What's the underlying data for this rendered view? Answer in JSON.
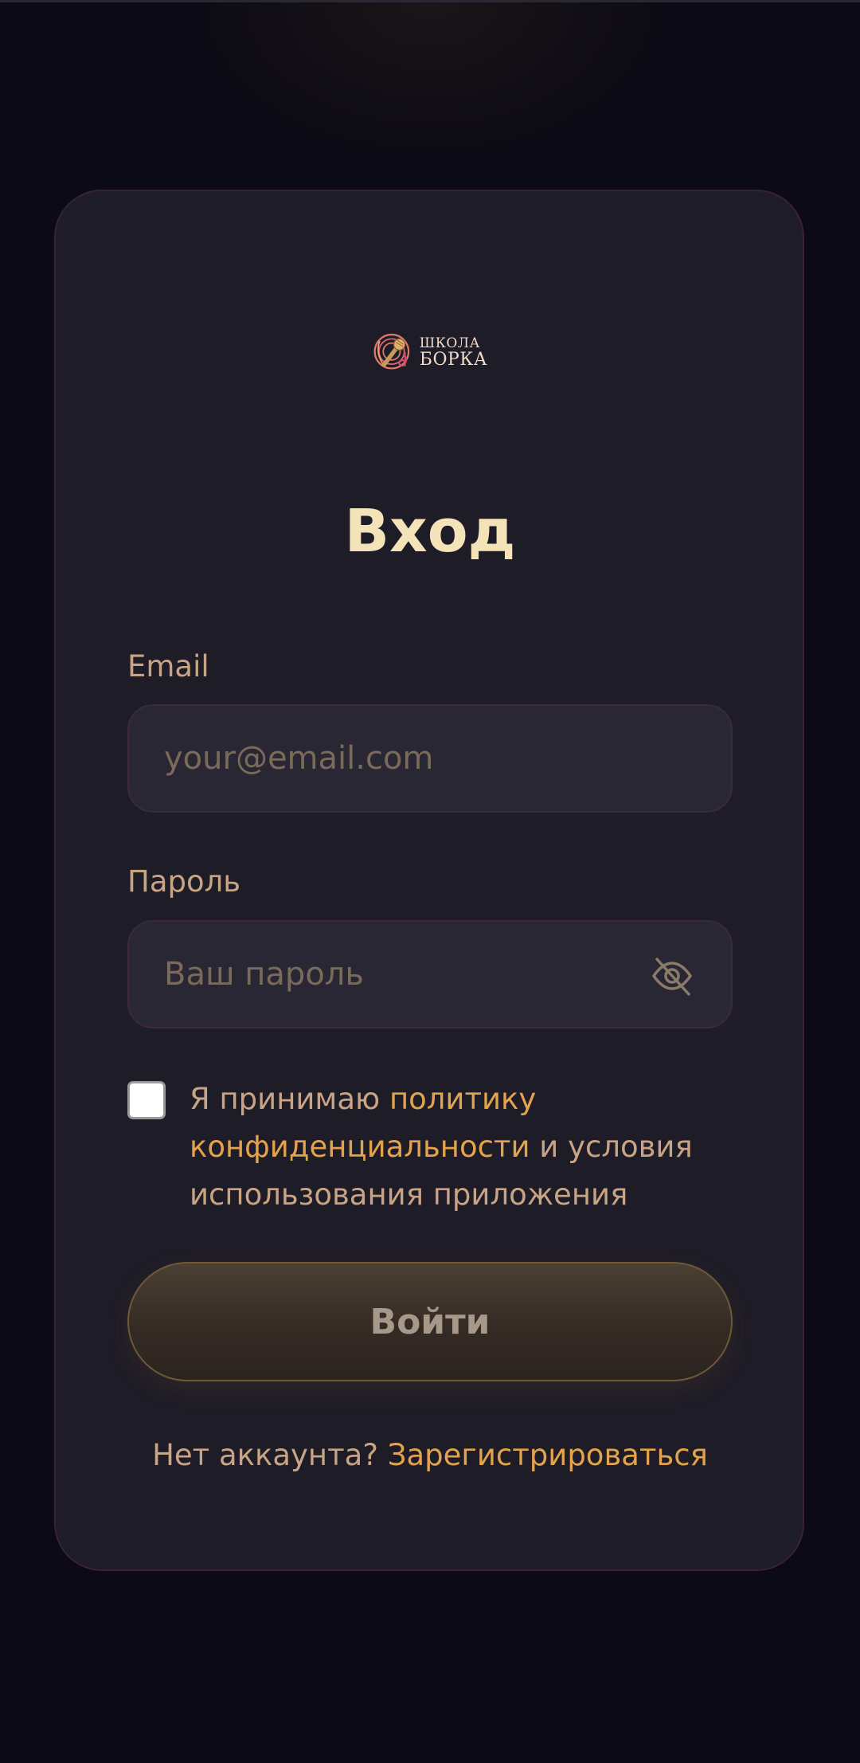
{
  "logo": {
    "line1": "ШКОЛА",
    "line2": "БОРКА"
  },
  "title": "Вход",
  "email": {
    "label": "Email",
    "placeholder": "your@email.com",
    "value": ""
  },
  "password": {
    "label": "Пароль",
    "placeholder": "Ваш пароль",
    "value": "",
    "toggle_icon": "eye-off-icon"
  },
  "consent": {
    "checked": false,
    "prefix": "Я принимаю ",
    "policy_link": "политику конфиденциальности",
    "suffix": " и условия использования приложения"
  },
  "login_button": "Войти",
  "register": {
    "prompt": "Нет аккаунта? ",
    "link": "Зарегистрироваться"
  },
  "colors": {
    "background": "#0c0a14",
    "card": "#1e1c27",
    "title": "#f4e2b8",
    "label": "#c8a384",
    "accent": "#e3a34c"
  }
}
